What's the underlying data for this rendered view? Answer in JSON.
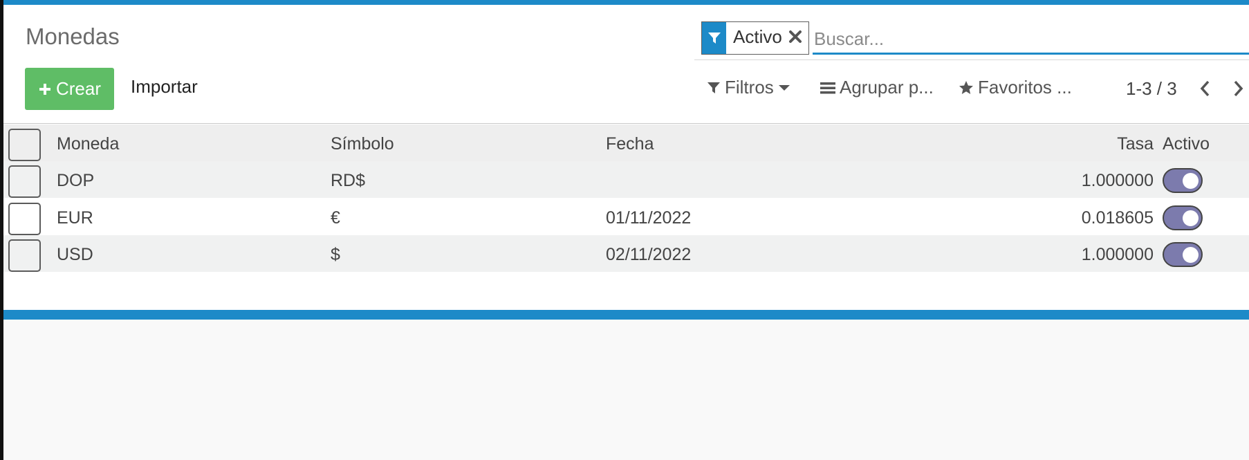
{
  "page": {
    "title": "Monedas"
  },
  "search": {
    "facet_label": "Activo",
    "placeholder": "Buscar..."
  },
  "toolbar": {
    "create_label": "Crear",
    "import_label": "Importar"
  },
  "controls": {
    "filters_label": "Filtros",
    "group_label": "Agrupar p...",
    "favorites_label": "Favoritos ..."
  },
  "pager": {
    "text": "1-3 / 3"
  },
  "table": {
    "columns": [
      "Moneda",
      "Símbolo",
      "Fecha",
      "Tasa",
      "Activo"
    ],
    "rows": [
      {
        "moneda": "DOP",
        "simbolo": "RD$",
        "fecha": "",
        "tasa": "1.000000",
        "activo": true
      },
      {
        "moneda": "EUR",
        "simbolo": "€",
        "fecha": "01/11/2022",
        "tasa": "0.018605",
        "activo": true
      },
      {
        "moneda": "USD",
        "simbolo": "$",
        "fecha": "02/11/2022",
        "tasa": "1.000000",
        "activo": true
      }
    ]
  },
  "colors": {
    "primary": "#1d8ac8",
    "create_button": "#5fbd66",
    "toggle_on": "#7c7bad"
  },
  "icons": {
    "facet": "filter-icon",
    "facet_remove": "close-icon",
    "create": "plus-icon",
    "filters": "filter-icon",
    "group": "list-icon",
    "favorites": "star-icon",
    "prev": "chevron-left-icon",
    "next": "chevron-right-icon"
  }
}
